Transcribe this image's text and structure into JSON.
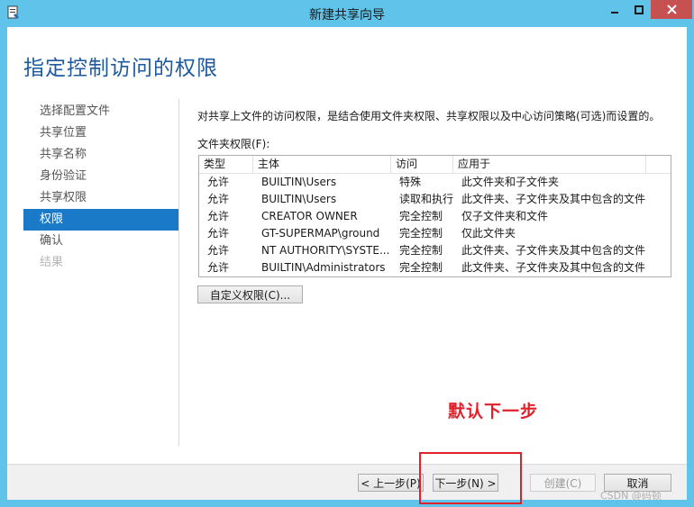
{
  "window": {
    "title": "新建共享向导",
    "app_icon": "wizard-icon",
    "titlebar_color": "#5fc3ea",
    "close_button_color": "#c75050"
  },
  "page": {
    "heading": "指定控制访问的权限"
  },
  "steps": [
    {
      "label": "选择配置文件",
      "state": "normal"
    },
    {
      "label": "共享位置",
      "state": "normal"
    },
    {
      "label": "共享名称",
      "state": "normal"
    },
    {
      "label": "身份验证",
      "state": "normal"
    },
    {
      "label": "共享权限",
      "state": "normal"
    },
    {
      "label": "权限",
      "state": "active"
    },
    {
      "label": "确认",
      "state": "normal"
    },
    {
      "label": "结果",
      "state": "disabled"
    }
  ],
  "main": {
    "description": "对共享上文件的访问权限，是结合使用文件夹权限、共享权限以及中心访问策略(可选)而设置的。",
    "folder_permissions_label": "文件夹权限(F):",
    "table": {
      "headers": [
        "类型",
        "主体",
        "访问",
        "应用于"
      ],
      "rows": [
        [
          "允许",
          "BUILTIN\\Users",
          "特殊",
          "此文件夹和子文件夹"
        ],
        [
          "允许",
          "BUILTIN\\Users",
          "读取和执行",
          "此文件夹、子文件夹及其中包含的文件"
        ],
        [
          "允许",
          "CREATOR OWNER",
          "完全控制",
          "仅子文件夹和文件"
        ],
        [
          "允许",
          "GT-SUPERMAP\\ground",
          "完全控制",
          "仅此文件夹"
        ],
        [
          "允许",
          "NT AUTHORITY\\SYSTE...",
          "完全控制",
          "此文件夹、子文件夹及其中包含的文件"
        ],
        [
          "允许",
          "BUILTIN\\Administrators",
          "完全控制",
          "此文件夹、子文件夹及其中包含的文件"
        ]
      ]
    },
    "custom_permissions_button": "自定义权限(C)...",
    "annotation": "默认下一步"
  },
  "footer": {
    "prev_label": "< 上一步(P)",
    "next_label": "下一步(N) >",
    "create_label": "创建(C)",
    "cancel_label": "取消"
  },
  "watermark": "CSDN @码顿",
  "annotation_color": "#e0202a",
  "active_step_color": "#1a7ac8"
}
